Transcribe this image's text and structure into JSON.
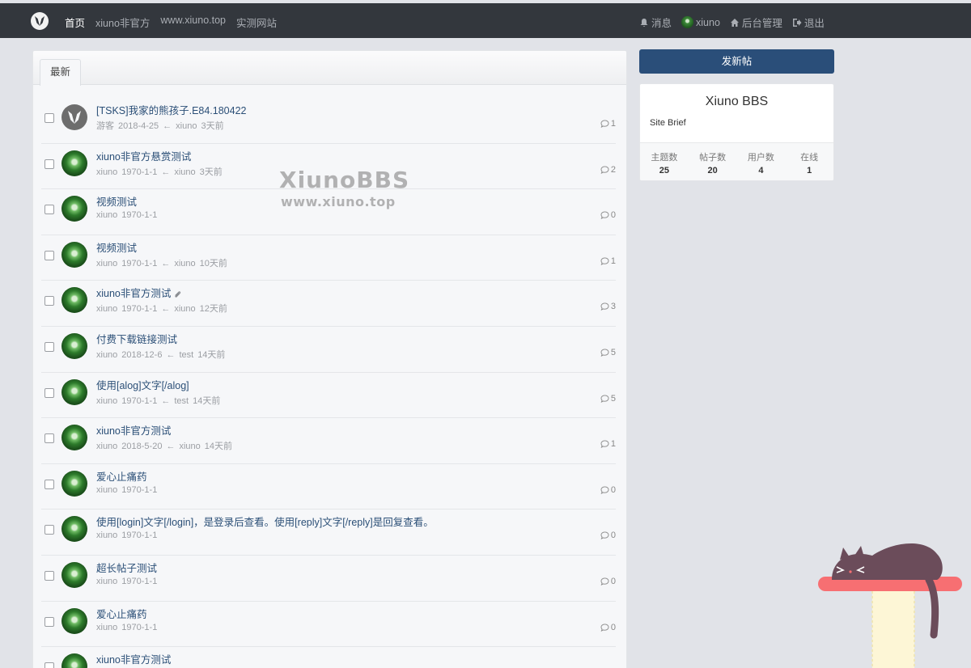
{
  "nav": {
    "home": "首页",
    "links": [
      "xiuno非官方",
      "www.xiuno.top",
      "实测网站"
    ],
    "messages": "消息",
    "user": "xiuno",
    "admin": "后台管理",
    "logout": "退出"
  },
  "tab_label": "最新",
  "threads": [
    {
      "subject": "[TSKS]我家的熊孩子.E84.180422",
      "author": "游客",
      "date": "2018-4-25",
      "last_user": "xiuno",
      "last_time": "3天前",
      "replies": "1",
      "avatar": "logo"
    },
    {
      "subject": "xiuno非官方悬赏测试",
      "author": "xiuno",
      "date": "1970-1-1",
      "last_user": "xiuno",
      "last_time": "3天前",
      "replies": "2",
      "avatar": "green"
    },
    {
      "subject": "视频测试",
      "author": "xiuno",
      "date": "1970-1-1",
      "last_user": "",
      "last_time": "",
      "replies": "0",
      "avatar": "green"
    },
    {
      "subject": "视频测试",
      "author": "xiuno",
      "date": "1970-1-1",
      "last_user": "xiuno",
      "last_time": "10天前",
      "replies": "1",
      "avatar": "green"
    },
    {
      "subject": "xiuno非官方测试",
      "author": "xiuno",
      "date": "1970-1-1",
      "last_user": "xiuno",
      "last_time": "12天前",
      "replies": "3",
      "avatar": "green",
      "attachment": true
    },
    {
      "subject": "付费下载链接测试",
      "author": "xiuno",
      "date": "2018-12-6",
      "last_user": "test",
      "last_time": "14天前",
      "replies": "5",
      "avatar": "green"
    },
    {
      "subject": "使用[alog]文字[/alog]",
      "author": "xiuno",
      "date": "1970-1-1",
      "last_user": "test",
      "last_time": "14天前",
      "replies": "5",
      "avatar": "green"
    },
    {
      "subject": "xiuno非官方测试",
      "author": "xiuno",
      "date": "2018-5-20",
      "last_user": "xiuno",
      "last_time": "14天前",
      "replies": "1",
      "avatar": "green"
    },
    {
      "subject": "爱心止痛药",
      "author": "xiuno",
      "date": "1970-1-1",
      "last_user": "",
      "last_time": "",
      "replies": "0",
      "avatar": "green"
    },
    {
      "subject": "使用[login]文字[/login]，是登录后查看。使用[reply]文字[/reply]是回复查看。",
      "author": "xiuno",
      "date": "1970-1-1",
      "last_user": "",
      "last_time": "",
      "replies": "0",
      "avatar": "green"
    },
    {
      "subject": "超长帖子测试",
      "author": "xiuno",
      "date": "1970-1-1",
      "last_user": "",
      "last_time": "",
      "replies": "0",
      "avatar": "green"
    },
    {
      "subject": "爱心止痛药",
      "author": "xiuno",
      "date": "1970-1-1",
      "last_user": "",
      "last_time": "",
      "replies": "0",
      "avatar": "green"
    },
    {
      "subject": "xiuno非官方测试",
      "author": "",
      "date": "",
      "last_user": "",
      "last_time": "",
      "replies": "",
      "avatar": "green"
    }
  ],
  "watermark": {
    "line1": "XiunoBBS",
    "line2": "www.xiuno.top"
  },
  "sidebar": {
    "new_thread": "发新帖",
    "site_name": "Xiuno BBS",
    "brief": "Site Brief",
    "stats": [
      {
        "label": "主题数",
        "value": "25"
      },
      {
        "label": "帖子数",
        "value": "20"
      },
      {
        "label": "用户数",
        "value": "4"
      },
      {
        "label": "在线",
        "value": "1"
      }
    ]
  },
  "colors": {
    "navbar": "#33373d",
    "primary": "#2a4e79",
    "link": "#2b4f77"
  }
}
